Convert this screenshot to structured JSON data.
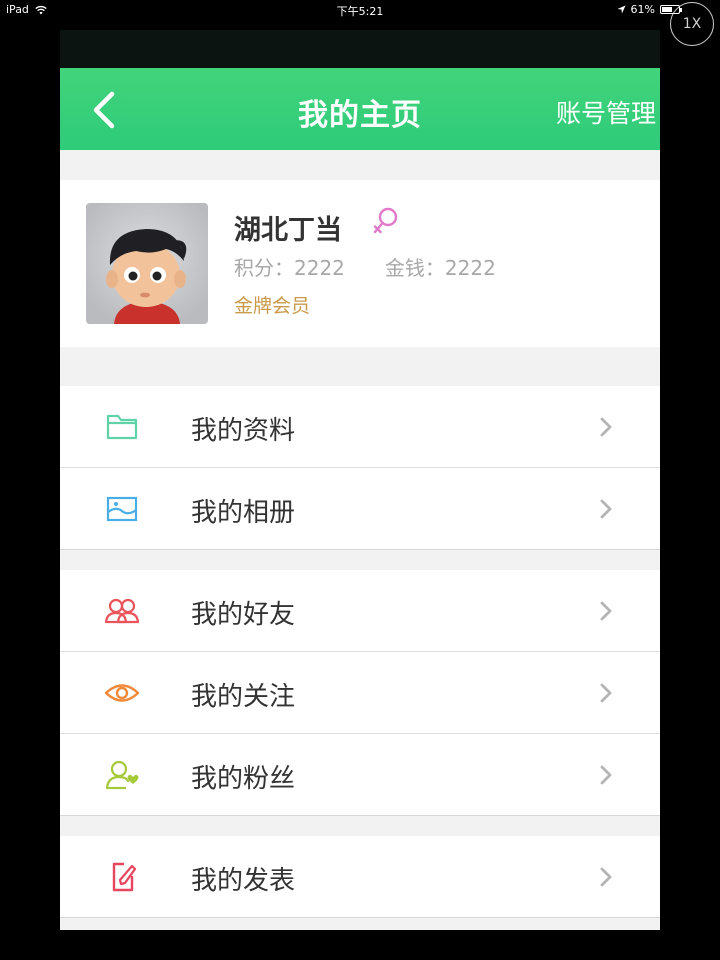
{
  "status_bar": {
    "device": "iPad",
    "time": "下午5:21",
    "battery": "61%",
    "battery_level": 0.61,
    "zoom_label": "1X"
  },
  "nav": {
    "title": "我的主页",
    "right_label": "账号管理",
    "back_icon": "chevron-left-icon"
  },
  "profile": {
    "name": "湖北丁当",
    "gender_icon": "female-icon",
    "score": "积分：2222",
    "money": "金钱：2222",
    "level": "金牌会员"
  },
  "menu": [
    {
      "label": "我的资料",
      "icon": "folder-icon",
      "color": "#5fd3a7"
    },
    {
      "label": "我的相册",
      "icon": "image-icon",
      "color": "#4aaee6"
    },
    {
      "label": "我的好友",
      "icon": "friends-icon",
      "color": "#e8545a"
    },
    {
      "label": "我的关注",
      "icon": "eye-icon",
      "color": "#f08a3a"
    },
    {
      "label": "我的粉丝",
      "icon": "fan-icon",
      "color": "#a6c93a"
    },
    {
      "label": "我的发表",
      "icon": "edit-icon",
      "color": "#e8455f"
    }
  ],
  "colors": {
    "nav_green": "#2ecb79",
    "level_gold": "#c99a4a",
    "gender_pink": "#e07bc9"
  }
}
